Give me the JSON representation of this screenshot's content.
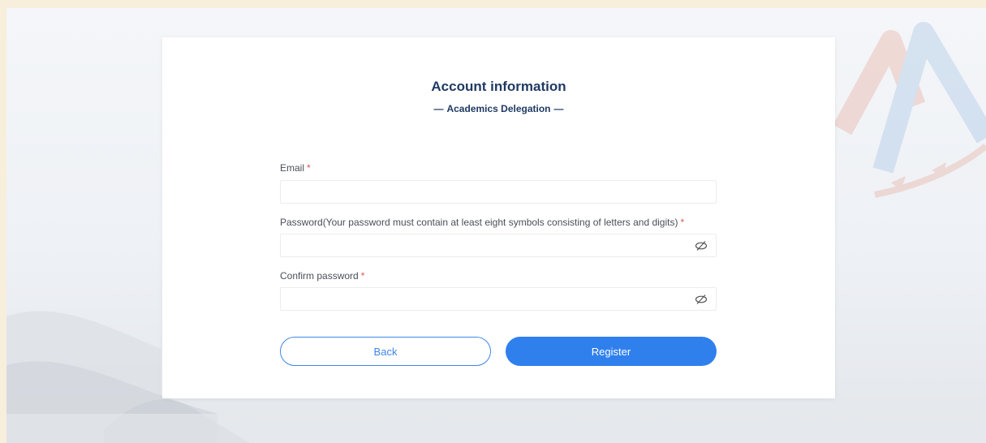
{
  "form": {
    "title": "Account information",
    "subtitle": "Academics Delegation",
    "subtitle_dash": "—",
    "required_mark": "*",
    "email": {
      "label": "Email",
      "value": "",
      "placeholder": ""
    },
    "password": {
      "label": "Password(Your password must contain at least eight symbols consisting of letters and digits)",
      "value": "",
      "placeholder": ""
    },
    "confirm_password": {
      "label": "Confirm password",
      "value": "",
      "placeholder": ""
    }
  },
  "buttons": {
    "back": "Back",
    "register": "Register"
  },
  "icons": {
    "password_toggle": "eye-slash-icon"
  },
  "colors": {
    "primary": "#2f80ed",
    "title": "#1f3a63",
    "required": "#e2554f",
    "page_border": "#f8eedc"
  }
}
